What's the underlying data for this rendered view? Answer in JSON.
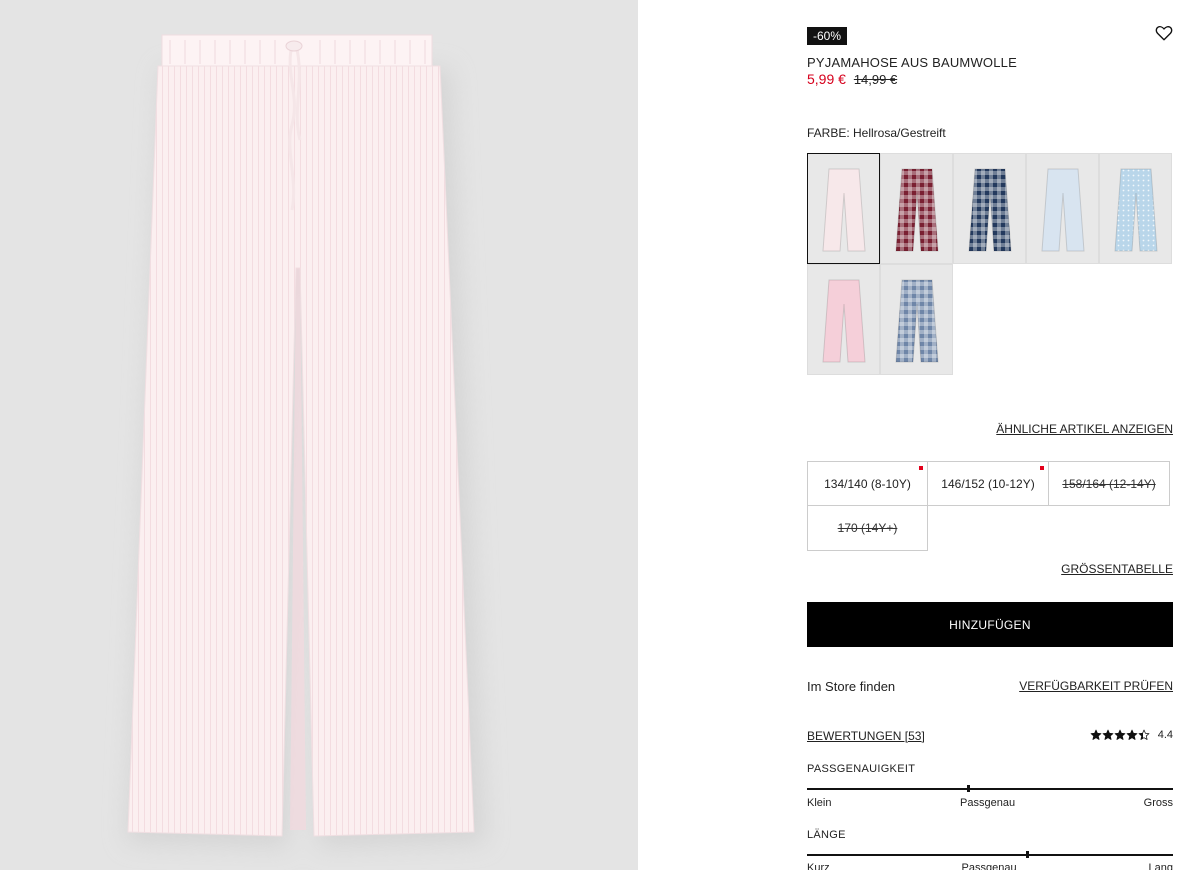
{
  "product": {
    "discount_badge": "-60%",
    "title": "PYJAMAHOSE AUS BAUMWOLLE",
    "price_sale": "5,99 €",
    "price_original": "14,99 €"
  },
  "colors": {
    "label": "FARBE: Hellrosa/Gestreift",
    "swatches": [
      {
        "name": "Hellrosa/Gestreift",
        "color": "#f7e8ea",
        "pattern": "plain",
        "selected": true
      },
      {
        "name": "Rot kariert",
        "color": "#7a2032",
        "pattern": "check",
        "selected": false
      },
      {
        "name": "Dunkelblau kariert",
        "color": "#243a5e",
        "pattern": "check",
        "selected": false
      },
      {
        "name": "Hellblau",
        "color": "#d8e4f0",
        "pattern": "plain",
        "selected": false
      },
      {
        "name": "Hellblau gemustert",
        "color": "#b9d6ea",
        "pattern": "dots",
        "selected": false
      },
      {
        "name": "Rosa",
        "color": "#f5cfd9",
        "pattern": "plain",
        "selected": false
      },
      {
        "name": "Blau kariert",
        "color": "#6f86a8",
        "pattern": "check",
        "selected": false
      }
    ]
  },
  "links": {
    "similar": "ÄHNLICHE ARTIKEL ANZEIGEN",
    "size_chart": "GRÖSSENTABELLE",
    "availability": "VERFÜGBARKEIT PRÜFEN",
    "reviews": "BEWERTUNGEN [53]"
  },
  "sizes": [
    {
      "label": "134/140 (8-10Y)",
      "available": true,
      "low_stock": true
    },
    {
      "label": "146/152 (10-12Y)",
      "available": true,
      "low_stock": true
    },
    {
      "label": "158/164 (12-14Y)",
      "available": false,
      "low_stock": false
    },
    {
      "label": "170 (14Y+)",
      "available": false,
      "low_stock": false
    }
  ],
  "add_button": "HINZUFÜGEN",
  "store_text": "Im Store finden",
  "rating": {
    "value": "4.4",
    "stars": 4.4
  },
  "fit": {
    "label": "PASSGENAUIGKEIT",
    "low": "Klein",
    "mid": "Passgenau",
    "high": "Gross",
    "position": 0.44
  },
  "length": {
    "label": "LÄNGE",
    "low": "Kurz",
    "mid": "Passgenau",
    "high": "Lang",
    "position": 0.6
  },
  "accent_colors": {
    "sale": "#d6001c",
    "button": "#000000",
    "stock_dot": "#e3001b"
  }
}
